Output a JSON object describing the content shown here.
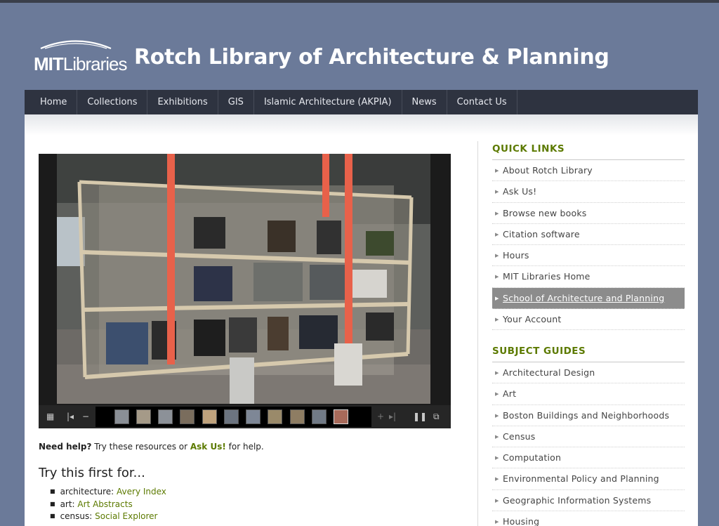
{
  "header": {
    "logo_bold": "MIT",
    "logo_light": "Libraries",
    "site_title": "Rotch Library of Architecture & Planning"
  },
  "nav": {
    "items": [
      {
        "label": "Home"
      },
      {
        "label": "Collections"
      },
      {
        "label": "Exhibitions"
      },
      {
        "label": "GIS"
      },
      {
        "label": "Islamic Architecture (AKPIA)"
      },
      {
        "label": "News"
      },
      {
        "label": "Contact Us"
      }
    ]
  },
  "slideshow": {
    "thumbnail_count": 11,
    "icons": [
      "grid-icon",
      "first-icon",
      "zoom-out-icon",
      "zoom-in-icon",
      "last-icon",
      "pause-icon",
      "fullscreen-icon"
    ]
  },
  "help": {
    "lead": "Need help?",
    "middle": " Try these resources or ",
    "ask_link": "Ask Us!",
    "tail": " for help."
  },
  "try_first": {
    "title": "Try this first for...",
    "items": [
      {
        "topic": "architecture: ",
        "link": "Avery Index"
      },
      {
        "topic": "art: ",
        "link": "Art Abstracts"
      },
      {
        "topic": "census: ",
        "link": "Social Explorer"
      }
    ]
  },
  "quick_links": {
    "heading": "QUICK LINKS",
    "items": [
      {
        "label": "About Rotch Library"
      },
      {
        "label": "Ask Us!"
      },
      {
        "label": "Browse new books"
      },
      {
        "label": "Citation software"
      },
      {
        "label": "Hours"
      },
      {
        "label": "MIT Libraries Home"
      },
      {
        "label": "School of Architecture and Planning"
      },
      {
        "label": "Your Account"
      }
    ]
  },
  "subject_guides": {
    "heading": "SUBJECT GUIDES",
    "items": [
      {
        "label": "Architectural Design"
      },
      {
        "label": "Art"
      },
      {
        "label": "Boston Buildings and Neighborhoods"
      },
      {
        "label": "Census"
      },
      {
        "label": "Computation"
      },
      {
        "label": "Environmental Policy and Planning"
      },
      {
        "label": "Geographic Information Systems"
      },
      {
        "label": "Housing"
      }
    ]
  },
  "colors": {
    "background": "#6b7a99",
    "nav": "#2e3340",
    "accent_green": "#5c7a00",
    "active_item": "#8c8c8c"
  }
}
